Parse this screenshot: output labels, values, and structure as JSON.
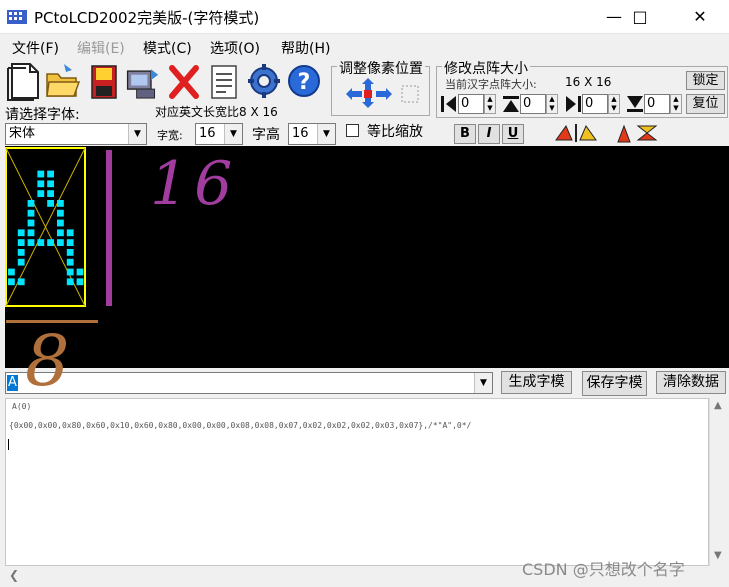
{
  "window": {
    "title": "PCtoLCD2002完美版-(字符模式)"
  },
  "menu": [
    "文件(F)",
    "编辑(E)",
    "模式(C)",
    "选项(O)",
    "帮助(H)"
  ],
  "font_select": {
    "label": "请选择字体:",
    "value": "宋体"
  },
  "en_ratio": {
    "label": "对应英文长宽比",
    "value": "8 X 16"
  },
  "width_select": {
    "label": "字宽:",
    "value": "16"
  },
  "height_select": {
    "label": "字高",
    "value": "16"
  },
  "scale_checkbox": {
    "label": "等比缩放"
  },
  "format_buttons": [
    "B",
    "I",
    "U"
  ],
  "pixel_adjust": {
    "title": "调整像素位置"
  },
  "dot_matrix": {
    "title": "修改点阵大小",
    "current_label": "当前汉字点阵大小:",
    "current_value": "16 X 16",
    "lock_button": "锁定",
    "reset_button": "复位",
    "spin_values": [
      "0",
      "0",
      "0",
      "0"
    ]
  },
  "annotations": {
    "height_note": "16",
    "width_note": "8"
  },
  "input": {
    "value": "A"
  },
  "buttons": {
    "generate": "生成字模",
    "save": "保存字模",
    "clear": "清除数据"
  },
  "output": {
    "line1": "A(0)",
    "line2": "{0x00,0x00,0x80,0x60,0x10,0x60,0x80,0x00,0x00,0x08,0x08,0x07,0x02,0x02,0x02,0x03,0x07},/*\"A\",0*/"
  },
  "watermark": "CSDN @只想改个名字",
  "colors": {
    "canvas_bg": "#000000",
    "pixel": "#00e5ff",
    "frame": "#ffff00",
    "purple_note": "#a23da0",
    "brown_note": "#b0703b"
  }
}
